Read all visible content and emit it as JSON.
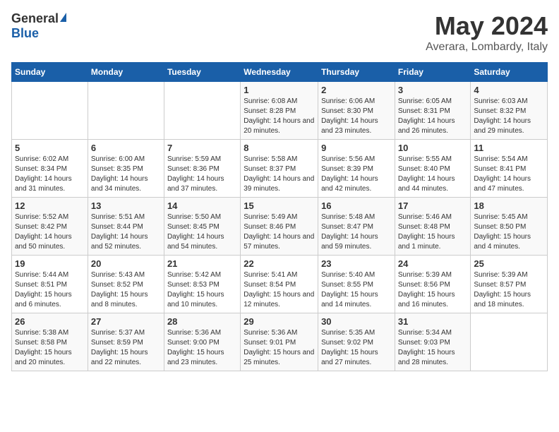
{
  "header": {
    "logo_general": "General",
    "logo_blue": "Blue",
    "month": "May 2024",
    "location": "Averara, Lombardy, Italy"
  },
  "weekdays": [
    "Sunday",
    "Monday",
    "Tuesday",
    "Wednesday",
    "Thursday",
    "Friday",
    "Saturday"
  ],
  "weeks": [
    [
      {
        "day": "",
        "info": ""
      },
      {
        "day": "",
        "info": ""
      },
      {
        "day": "",
        "info": ""
      },
      {
        "day": "1",
        "info": "Sunrise: 6:08 AM\nSunset: 8:28 PM\nDaylight: 14 hours and 20 minutes."
      },
      {
        "day": "2",
        "info": "Sunrise: 6:06 AM\nSunset: 8:30 PM\nDaylight: 14 hours and 23 minutes."
      },
      {
        "day": "3",
        "info": "Sunrise: 6:05 AM\nSunset: 8:31 PM\nDaylight: 14 hours and 26 minutes."
      },
      {
        "day": "4",
        "info": "Sunrise: 6:03 AM\nSunset: 8:32 PM\nDaylight: 14 hours and 29 minutes."
      }
    ],
    [
      {
        "day": "5",
        "info": "Sunrise: 6:02 AM\nSunset: 8:34 PM\nDaylight: 14 hours and 31 minutes."
      },
      {
        "day": "6",
        "info": "Sunrise: 6:00 AM\nSunset: 8:35 PM\nDaylight: 14 hours and 34 minutes."
      },
      {
        "day": "7",
        "info": "Sunrise: 5:59 AM\nSunset: 8:36 PM\nDaylight: 14 hours and 37 minutes."
      },
      {
        "day": "8",
        "info": "Sunrise: 5:58 AM\nSunset: 8:37 PM\nDaylight: 14 hours and 39 minutes."
      },
      {
        "day": "9",
        "info": "Sunrise: 5:56 AM\nSunset: 8:39 PM\nDaylight: 14 hours and 42 minutes."
      },
      {
        "day": "10",
        "info": "Sunrise: 5:55 AM\nSunset: 8:40 PM\nDaylight: 14 hours and 44 minutes."
      },
      {
        "day": "11",
        "info": "Sunrise: 5:54 AM\nSunset: 8:41 PM\nDaylight: 14 hours and 47 minutes."
      }
    ],
    [
      {
        "day": "12",
        "info": "Sunrise: 5:52 AM\nSunset: 8:42 PM\nDaylight: 14 hours and 50 minutes."
      },
      {
        "day": "13",
        "info": "Sunrise: 5:51 AM\nSunset: 8:44 PM\nDaylight: 14 hours and 52 minutes."
      },
      {
        "day": "14",
        "info": "Sunrise: 5:50 AM\nSunset: 8:45 PM\nDaylight: 14 hours and 54 minutes."
      },
      {
        "day": "15",
        "info": "Sunrise: 5:49 AM\nSunset: 8:46 PM\nDaylight: 14 hours and 57 minutes."
      },
      {
        "day": "16",
        "info": "Sunrise: 5:48 AM\nSunset: 8:47 PM\nDaylight: 14 hours and 59 minutes."
      },
      {
        "day": "17",
        "info": "Sunrise: 5:46 AM\nSunset: 8:48 PM\nDaylight: 15 hours and 1 minute."
      },
      {
        "day": "18",
        "info": "Sunrise: 5:45 AM\nSunset: 8:50 PM\nDaylight: 15 hours and 4 minutes."
      }
    ],
    [
      {
        "day": "19",
        "info": "Sunrise: 5:44 AM\nSunset: 8:51 PM\nDaylight: 15 hours and 6 minutes."
      },
      {
        "day": "20",
        "info": "Sunrise: 5:43 AM\nSunset: 8:52 PM\nDaylight: 15 hours and 8 minutes."
      },
      {
        "day": "21",
        "info": "Sunrise: 5:42 AM\nSunset: 8:53 PM\nDaylight: 15 hours and 10 minutes."
      },
      {
        "day": "22",
        "info": "Sunrise: 5:41 AM\nSunset: 8:54 PM\nDaylight: 15 hours and 12 minutes."
      },
      {
        "day": "23",
        "info": "Sunrise: 5:40 AM\nSunset: 8:55 PM\nDaylight: 15 hours and 14 minutes."
      },
      {
        "day": "24",
        "info": "Sunrise: 5:39 AM\nSunset: 8:56 PM\nDaylight: 15 hours and 16 minutes."
      },
      {
        "day": "25",
        "info": "Sunrise: 5:39 AM\nSunset: 8:57 PM\nDaylight: 15 hours and 18 minutes."
      }
    ],
    [
      {
        "day": "26",
        "info": "Sunrise: 5:38 AM\nSunset: 8:58 PM\nDaylight: 15 hours and 20 minutes."
      },
      {
        "day": "27",
        "info": "Sunrise: 5:37 AM\nSunset: 8:59 PM\nDaylight: 15 hours and 22 minutes."
      },
      {
        "day": "28",
        "info": "Sunrise: 5:36 AM\nSunset: 9:00 PM\nDaylight: 15 hours and 23 minutes."
      },
      {
        "day": "29",
        "info": "Sunrise: 5:36 AM\nSunset: 9:01 PM\nDaylight: 15 hours and 25 minutes."
      },
      {
        "day": "30",
        "info": "Sunrise: 5:35 AM\nSunset: 9:02 PM\nDaylight: 15 hours and 27 minutes."
      },
      {
        "day": "31",
        "info": "Sunrise: 5:34 AM\nSunset: 9:03 PM\nDaylight: 15 hours and 28 minutes."
      },
      {
        "day": "",
        "info": ""
      }
    ]
  ]
}
